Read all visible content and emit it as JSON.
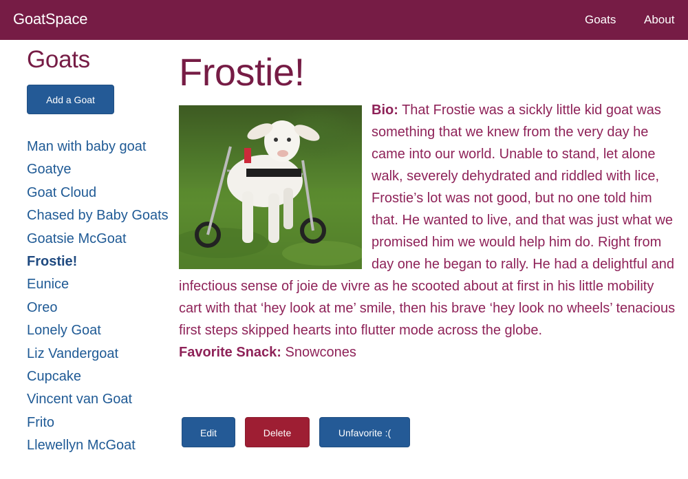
{
  "navbar": {
    "brand": "GoatSpace",
    "links": [
      "Goats",
      "About"
    ]
  },
  "sidebar": {
    "heading": "Goats",
    "add_button": "Add a Goat",
    "goats": [
      "Man with baby goat",
      "Goatye",
      "Goat Cloud",
      "Chased by Baby Goats",
      "Goatsie McGoat",
      "Frostie!",
      "Eunice",
      "Oreo",
      "Lonely Goat",
      "Liz Vandergoat",
      "Cupcake",
      "Vincent van Goat",
      "Frito",
      "Llewellyn McGoat"
    ],
    "active_goat": "Frostie!"
  },
  "goat": {
    "name": "Frostie!",
    "photo_icon": "goat-photo",
    "bio_label": "Bio:",
    "bio": "That Frostie was a sickly little kid goat was something that we knew from the very day he came into our world. Unable to stand, let alone walk, severely dehydrated and riddled with lice, Frostie’s lot was not good, but no one told him that. He wanted to live, and that was just what we promised him we would help him do. Right from day one he began to rally. He had a delightful and infectious sense of joie de vivre as he scooted about at first in his little mobility cart with that ‘hey look at me’ smile, then his brave ‘hey look no wheels’ tenacious first steps skipped hearts into flutter mode across the globe.",
    "snack_label": "Favorite Snack:",
    "snack": "Snowcones"
  },
  "actions": {
    "edit": "Edit",
    "delete": "Delete",
    "unfavorite": "Unfavorite :("
  },
  "colors": {
    "navbar": "#761c45",
    "primary_button": "#245a96",
    "danger_button": "#9e1e33",
    "link": "#1f5a95",
    "text": "#8e2258"
  }
}
